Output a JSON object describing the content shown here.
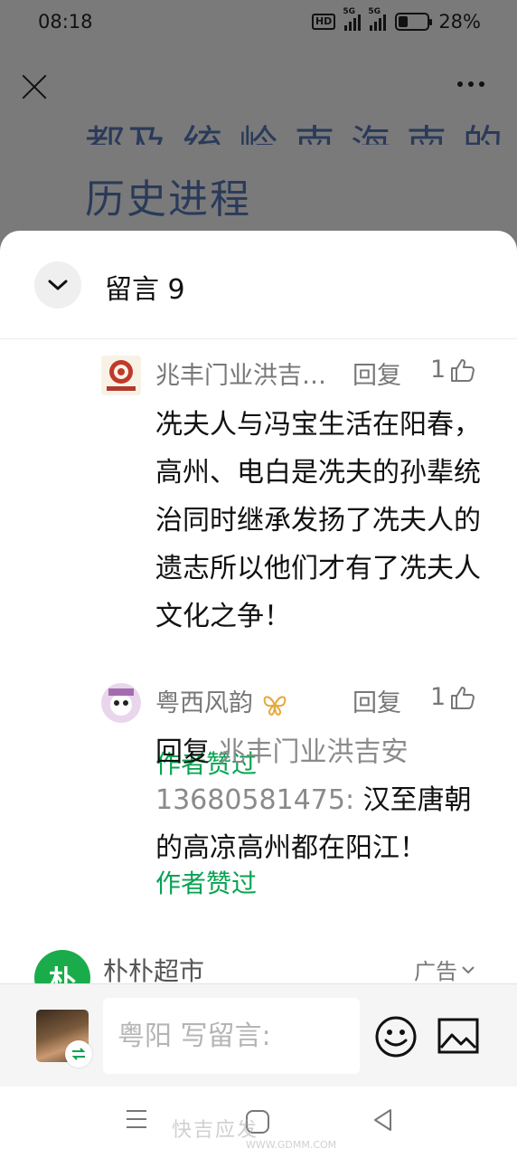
{
  "status_bar": {
    "time": "08:18",
    "hd_badge": "HD",
    "signal1_label": "5G",
    "signal2_label": "5G",
    "battery_level": 0.28,
    "battery_text": "28%"
  },
  "article": {
    "heading_partial": "都及 统   岭 南 海 南 的",
    "heading_line2": "历史进程"
  },
  "comments_panel": {
    "title": "留言 9",
    "comments": [
      {
        "author": "兆丰门业洪吉…",
        "reply_label": "回复",
        "likes": "1",
        "text": "冼夫人与冯宝生活在阳春，高州、电白是冼夫的孙辈统治同时继承发扬了冼夫人的遗志所以他们才有了冼夫人文化之争！",
        "author_liked": "作者赞过"
      },
      {
        "author": "粤西风韵",
        "reply_label": "回复",
        "likes": "1",
        "text_prefix": "回复 ",
        "reply_to": "兆丰门业洪吉安13680581475:",
        "text": " 汉至唐朝的高凉高州都在阳江！",
        "author_liked": "作者赞过"
      }
    ],
    "ad": {
      "logo_text": "朴",
      "name": "朴朴超市",
      "tag": "广告"
    }
  },
  "input_bar": {
    "placeholder": "粤阳 写留言:"
  },
  "watermark": {
    "main": "快吉应发",
    "sub": "WWW.GDMM.COM"
  },
  "colors": {
    "accent_green": "#07a352",
    "ad_green": "#1aac4a"
  }
}
